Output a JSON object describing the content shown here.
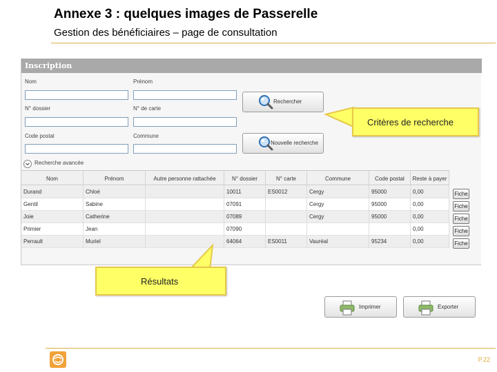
{
  "slide": {
    "title": "Annexe 3 : quelques images de Passerelle",
    "subtitle": "Gestion des bénéficiaires – page de consultation",
    "page_number": "P.22"
  },
  "app": {
    "header_title": "Inscription",
    "form": {
      "nom_label": "Nom",
      "prenom_label": "Prénom",
      "dossier_label": "N° dossier",
      "carte_label": "N° de carte",
      "postal_label": "Code postal",
      "commune_label": "Commune",
      "nom_value": "",
      "prenom_value": "",
      "dossier_value": "",
      "carte_value": "",
      "postal_value": "",
      "commune_value": ""
    },
    "buttons": {
      "search_label": "Rechercher",
      "new_search_label": "Nouvelle recherche",
      "advanced_label": "Recherche avancée",
      "fiche_label": "Fiche",
      "print_label": "Imprimer",
      "export_label": "Exporter"
    },
    "table": {
      "columns": [
        "Nom",
        "Prénom",
        "Autre personne rattachée",
        "N° dossier",
        "N° carte",
        "Commune",
        "Code postal",
        "Reste à payer"
      ],
      "rows": [
        [
          "Durand",
          "Chloé",
          "",
          "10011",
          "ES0012",
          "Cergy",
          "95000",
          "0,00"
        ],
        [
          "Gentil",
          "Sabine",
          "",
          "07091",
          "",
          "Cergy",
          "95000",
          "0,00"
        ],
        [
          "Joie",
          "Catherine",
          "",
          "07089",
          "",
          "Cergy",
          "95000",
          "0,00"
        ],
        [
          "Primier",
          "Jean",
          "",
          "07090",
          "",
          "",
          "",
          "0,00"
        ],
        [
          "Perrault",
          "Muriel",
          "",
          "64064",
          "ES0011",
          "Vauréal",
          "95234",
          "0,00"
        ]
      ]
    }
  },
  "callouts": {
    "criteria": "Critères de recherche",
    "results": "Résultats"
  },
  "icons": {
    "search": "magnifier-icon",
    "print": "printer-icon",
    "chevron": "chevron-down-icon",
    "logo": "company-logo"
  },
  "colors": {
    "accent_gold": "#d8b04a",
    "callout_yellow": "#ffff66",
    "header_gray": "#a9a9a9"
  }
}
